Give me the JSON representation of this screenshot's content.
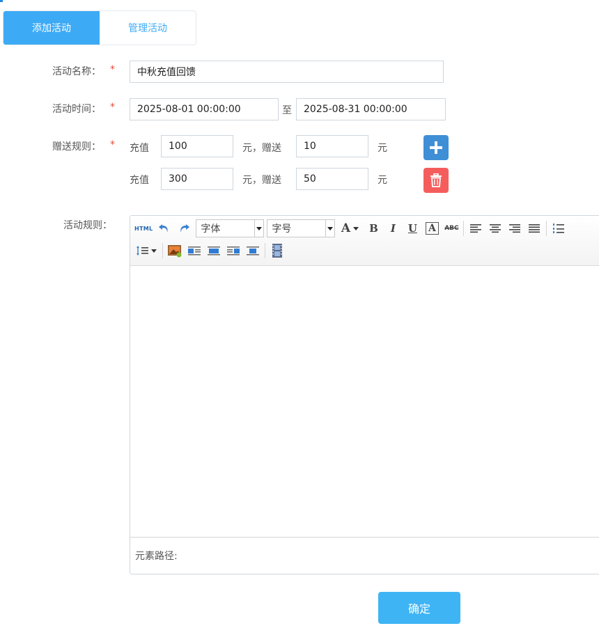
{
  "tabs": [
    {
      "label": "添加活动",
      "active": true
    },
    {
      "label": "管理活动",
      "active": false
    }
  ],
  "form": {
    "name_label": "活动名称：",
    "name_value": "中秋充值回馈",
    "time_label": "活动时间：",
    "start_time": "2025-08-01 00:00:00",
    "to_text": "至",
    "end_time": "2025-08-31 00:00:00",
    "rules_label": "赠送规则：",
    "required_mark": "*",
    "rules": [
      {
        "recharge_label": "充值",
        "recharge": "100",
        "gift_label": "元，赠送",
        "gift": "10",
        "unit": "元",
        "action_icon": "plus-icon"
      },
      {
        "recharge_label": "充值",
        "recharge": "300",
        "gift_label": "元，赠送",
        "gift": "50",
        "unit": "元",
        "action_icon": "trash-icon"
      }
    ],
    "activity_rules_label": "活动规则："
  },
  "editor": {
    "html_btn": "HTML",
    "font_family_placeholder": "字体",
    "font_size_placeholder": "字号",
    "font_color_glyph": "A",
    "bold_glyph": "B",
    "italic_glyph": "I",
    "underline_glyph": "U",
    "strike_glyph": "ABC",
    "boxed_glyph": "A",
    "status_path_label": "元素路径:"
  },
  "confirm_label": "确定",
  "colors": {
    "primary": "#3daaf5",
    "add_button": "#3f8fd6",
    "delete_button": "#f55d5d",
    "required": "#e74c3c"
  }
}
